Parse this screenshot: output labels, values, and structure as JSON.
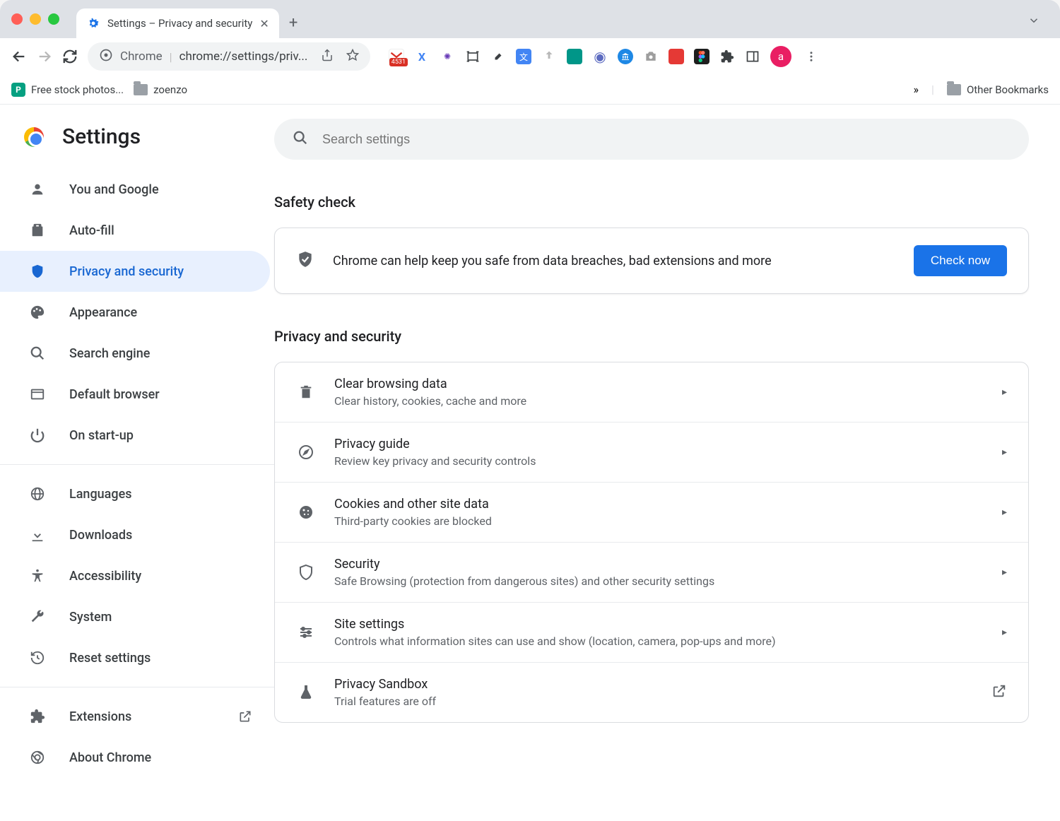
{
  "browser": {
    "tab_title": "Settings – Privacy and security",
    "url_label": "Chrome",
    "url_path": "chrome://settings/priv...",
    "avatar_letter": "a"
  },
  "bookmarks": {
    "items": [
      {
        "label": "Free stock photos..."
      },
      {
        "label": "zoenzo"
      }
    ],
    "other": "Other Bookmarks",
    "overflow": "»"
  },
  "extensions": {
    "gmail_badge": "4531"
  },
  "settings": {
    "title": "Settings",
    "search_placeholder": "Search settings",
    "nav": [
      {
        "id": "you-google",
        "label": "You and Google"
      },
      {
        "id": "autofill",
        "label": "Auto-fill"
      },
      {
        "id": "privacy",
        "label": "Privacy and security"
      },
      {
        "id": "appearance",
        "label": "Appearance"
      },
      {
        "id": "search-engine",
        "label": "Search engine"
      },
      {
        "id": "default-browser",
        "label": "Default browser"
      },
      {
        "id": "on-startup",
        "label": "On start-up"
      }
    ],
    "nav2": [
      {
        "id": "languages",
        "label": "Languages"
      },
      {
        "id": "downloads",
        "label": "Downloads"
      },
      {
        "id": "accessibility",
        "label": "Accessibility"
      },
      {
        "id": "system",
        "label": "System"
      },
      {
        "id": "reset",
        "label": "Reset settings"
      }
    ],
    "nav3": [
      {
        "id": "extensions",
        "label": "Extensions"
      },
      {
        "id": "about",
        "label": "About Chrome"
      }
    ]
  },
  "main": {
    "safety_header": "Safety check",
    "safety_text": "Chrome can help keep you safe from data breaches, bad extensions and more",
    "check_now": "Check now",
    "privacy_header": "Privacy and security",
    "rows": [
      {
        "title": "Clear browsing data",
        "sub": "Clear history, cookies, cache and more",
        "action": "arrow"
      },
      {
        "title": "Privacy guide",
        "sub": "Review key privacy and security controls",
        "action": "arrow"
      },
      {
        "title": "Cookies and other site data",
        "sub": "Third-party cookies are blocked",
        "action": "arrow"
      },
      {
        "title": "Security",
        "sub": "Safe Browsing (protection from dangerous sites) and other security settings",
        "action": "arrow"
      },
      {
        "title": "Site settings",
        "sub": "Controls what information sites can use and show (location, camera, pop-ups and more)",
        "action": "arrow"
      },
      {
        "title": "Privacy Sandbox",
        "sub": "Trial features are off",
        "action": "launch"
      }
    ]
  }
}
